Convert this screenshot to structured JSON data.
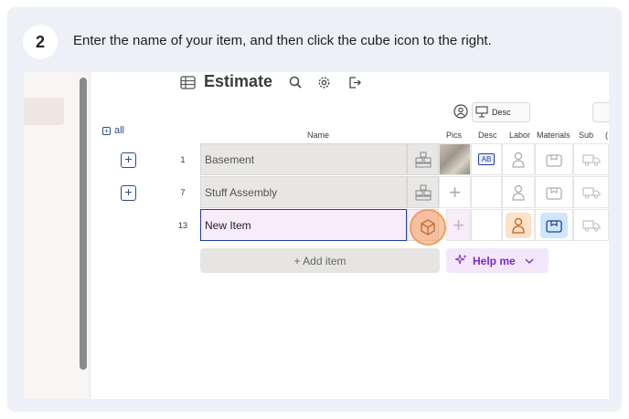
{
  "step": {
    "number": "2",
    "instruction": "Enter the name of your item, and then click the cube icon to the right."
  },
  "app": {
    "title": "Estimate",
    "icons": [
      "table-icon",
      "search-icon",
      "gear-icon",
      "export-icon"
    ]
  },
  "toolbar": {
    "desc_chip": "Desc"
  },
  "table": {
    "all_label": "all",
    "columns": [
      "Name",
      "Pics",
      "Desc",
      "Labor",
      "Materials",
      "Sub",
      "("
    ],
    "rows": [
      {
        "num": "1",
        "name": "Basement"
      },
      {
        "num": "7",
        "name": "Stuff Assembly"
      },
      {
        "num": "13",
        "name": "New Item"
      }
    ],
    "desc_badge": "AB",
    "add_item_label": "+ Add item",
    "help_me_label": "Help me"
  },
  "colors": {
    "accent_blue": "#1f3fa0",
    "active_row": "#f8ecfb",
    "labor_active": "#fde2c8",
    "materials_active": "#cfe6fb",
    "highlight": "#f39b5a",
    "help_purple": "#7b2cbf"
  }
}
